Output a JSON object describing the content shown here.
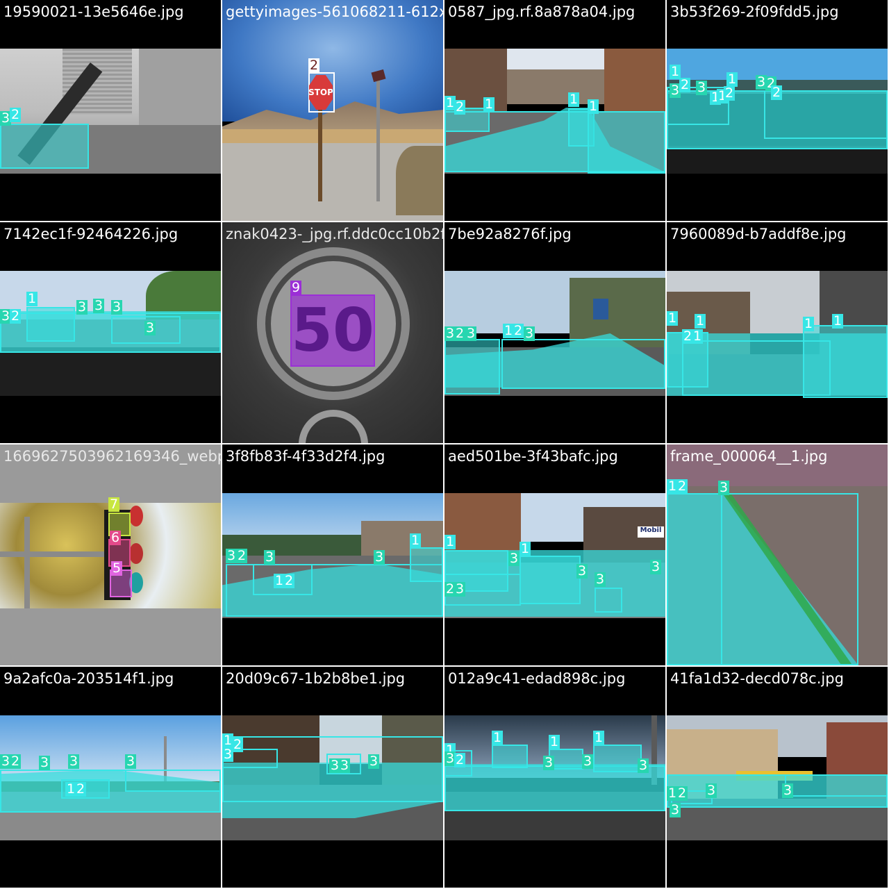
{
  "tiles": [
    {
      "filename": "19590021-13e5646e.jpg",
      "labels": [
        "3",
        "2"
      ]
    },
    {
      "filename": "gettyimages-561068211-612x612_jpg.rf.c379404.jpg",
      "labels": [
        "2"
      ],
      "sign_text": "STOP"
    },
    {
      "filename": "0587_jpg.rf.8a878a04.jpg",
      "labels": [
        "1",
        "2",
        "1",
        "1",
        "1"
      ]
    },
    {
      "filename": "3b53f269-2f09fdd5.jpg",
      "labels": [
        "1",
        "3",
        "2",
        "3",
        "1",
        "1",
        "2",
        "3",
        "2",
        "1",
        "2"
      ]
    },
    {
      "filename": "7142ec1f-92464226.jpg",
      "labels": [
        "3",
        "2",
        "1",
        "3",
        "3",
        "3",
        "3"
      ]
    },
    {
      "filename": "znak0423-_jpg.rf.ddc0cc10b2ffe849702008f576f.jpg",
      "labels": [
        "9"
      ],
      "sign_text": "50"
    },
    {
      "filename": "7be92a8276f.jpg",
      "labels": [
        "3",
        "2",
        "3",
        "1",
        "2",
        "3"
      ]
    },
    {
      "filename": "7960089d-b7addf8e.jpg",
      "labels": [
        "1",
        "1",
        "1",
        "2",
        "1",
        "1"
      ]
    },
    {
      "filename": "1669627503962169346_webp.rf.b3fa458a04f5.jpg",
      "labels": [
        "7",
        "6",
        "5"
      ]
    },
    {
      "filename": "3f8fb83f-4f33d2f4.jpg",
      "labels": [
        "3",
        "2",
        "3",
        "3",
        "1",
        "1",
        "2"
      ]
    },
    {
      "filename": "aed501be-3f43bafc.jpg",
      "labels": [
        "1",
        "3",
        "1",
        "3",
        "3",
        "3",
        "2",
        "3"
      ],
      "sign_text": "Mobil"
    },
    {
      "filename": "frame_000064__1.jpg",
      "labels": [
        "1",
        "2",
        "3"
      ]
    },
    {
      "filename": "9a2afc0a-203514f1.jpg",
      "labels": [
        "3",
        "2",
        "3",
        "3",
        "3",
        "1",
        "2"
      ]
    },
    {
      "filename": "20d09c67-1b2b8be1.jpg",
      "labels": [
        "1",
        "2",
        "3",
        "3",
        "3",
        "3"
      ]
    },
    {
      "filename": "012a9c41-edad898c.jpg",
      "labels": [
        "1",
        "3",
        "2",
        "1",
        "1",
        "1",
        "3",
        "3",
        "3"
      ]
    },
    {
      "filename": "41fa1d32-decd078c.jpg",
      "labels": [
        "1",
        "2",
        "3",
        "3",
        "3"
      ]
    }
  ],
  "colors": {
    "lane": "#37e6e6",
    "label_teal": "#27d6b0",
    "sign_purple": "#9b2fd6",
    "traffic_light": "#e34a8a"
  }
}
